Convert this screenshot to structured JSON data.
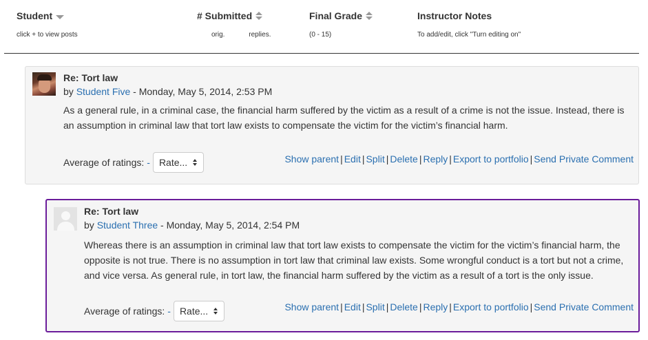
{
  "header": {
    "student": {
      "title": "Student",
      "sub": "click + to view posts"
    },
    "submitted": {
      "title": "# Submitted",
      "sub_orig": "orig.",
      "sub_replies": "replies."
    },
    "grade": {
      "title": "Final Grade",
      "sub": "(0 - 15)"
    },
    "notes": {
      "title": "Instructor Notes",
      "sub": "To add/edit, click \"Turn editing on\""
    }
  },
  "posts": [
    {
      "subject": "Re: Tort law",
      "by": "by",
      "author": "Student Five",
      "date": " - Monday, May 5, 2014, 2:53 PM",
      "content": "As a general rule, in a criminal case, the financial harm suffered by the victim as a result of a crime is not the issue. Instead, there is an assumption in criminal law that tort law exists to compensate the victim for the victim’s financial harm.",
      "avg_label": "Average of ratings:",
      "avg_value": "-",
      "rate_label": "Rate...",
      "links": [
        "Show parent",
        "Edit",
        "Split",
        "Delete",
        "Reply",
        "Export to portfolio",
        "Send Private Comment"
      ]
    },
    {
      "subject": "Re: Tort law",
      "by": "by",
      "author": "Student Three",
      "date": " - Monday, May 5, 2014, 2:54 PM",
      "content": "Whereas there is an assumption in criminal law that tort law exists to compensate the victim for the victim’s financial harm, the opposite is not true. There is no assumption in tort law that criminal law exists. Some wrongful conduct is a tort but not a crime, and vice versa. As general rule, in tort law, the financial harm suffered by the victim as a result of a tort is the only issue.",
      "avg_label": "Average of ratings:",
      "avg_value": "-",
      "rate_label": "Rate...",
      "links": [
        "Show parent",
        "Edit",
        "Split",
        "Delete",
        "Reply",
        "Export to portfolio",
        "Send Private Comment"
      ]
    }
  ],
  "colors": {
    "link": "#2a6fb0",
    "highlight_border": "#6a1b9a",
    "post_bg": "#f5f5f5"
  },
  "icons": [
    "sort-down-icon",
    "sort-icon",
    "avatar-photo",
    "avatar-placeholder",
    "select-updown-icon"
  ]
}
